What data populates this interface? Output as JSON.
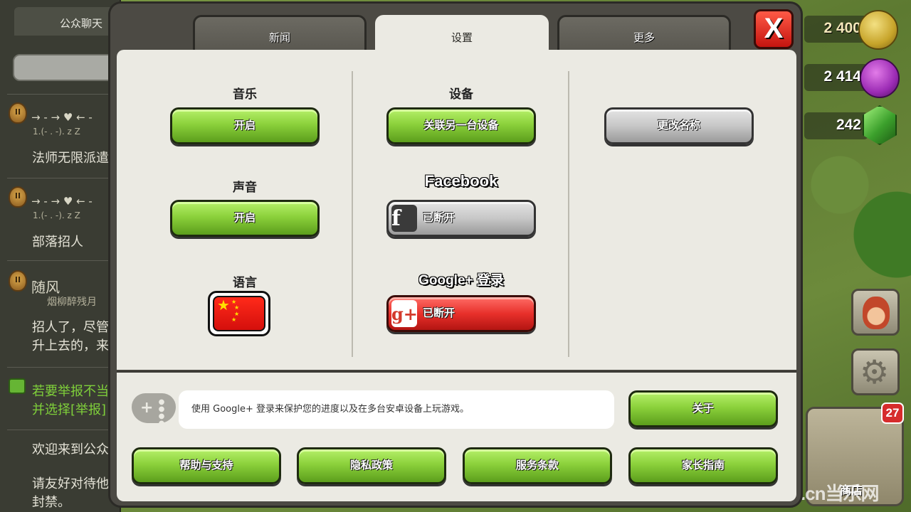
{
  "chat": {
    "tab_label": "公众聊天",
    "messages": [
      {
        "badge": "II",
        "name": "→ - → ♥ ← -",
        "clan": "1.(- . -). z Z",
        "text": "法师无限派遣"
      },
      {
        "badge": "II",
        "name": "→ - → ♥ ← -",
        "clan": "1.(- . -). z Z",
        "text": "部落招人"
      },
      {
        "badge": "II",
        "name": "随风",
        "clan": "烟柳醉残月",
        "text": "招人了，尽管",
        "text2": "升上去的，来"
      },
      {
        "warning1": "若要举报不当",
        "warning2": "并选择[举报]"
      },
      {
        "text": "欢迎来到公众"
      },
      {
        "text": "请友好对待他",
        "text2": "封禁。"
      }
    ]
  },
  "hud": {
    "gold": "2 400",
    "elixir": "2 414",
    "gems": "242",
    "shop_badge": "27",
    "shop_label": "商店",
    "watermark": "d.cn当乐网"
  },
  "tabs": {
    "news": "新闻",
    "settings": "设置",
    "more": "更多"
  },
  "close_label": "X",
  "settings": {
    "music_label": "音乐",
    "music_button": "开启",
    "sound_label": "声音",
    "sound_button": "开启",
    "language_label": "语言",
    "device_label": "设备",
    "device_button": "关联另一台设备",
    "facebook_label": "Facebook",
    "facebook_button": "已断开",
    "google_label": "Google+ 登录",
    "google_button": "已断开",
    "rename_button": "更改名称"
  },
  "footer": {
    "info_text": "使用 Google+ 登录来保护您的进度以及在多台安卓设备上玩游戏。",
    "about_button": "关于",
    "help_button": "帮助与支持",
    "privacy_button": "隐私政策",
    "terms_button": "服务条款",
    "parents_button": "家长指南"
  },
  "colors": {
    "green_button": "#8bd13b",
    "red_button": "#e8302b",
    "grey_button": "#c7c7c7",
    "panel_bg": "#ebeae3"
  }
}
